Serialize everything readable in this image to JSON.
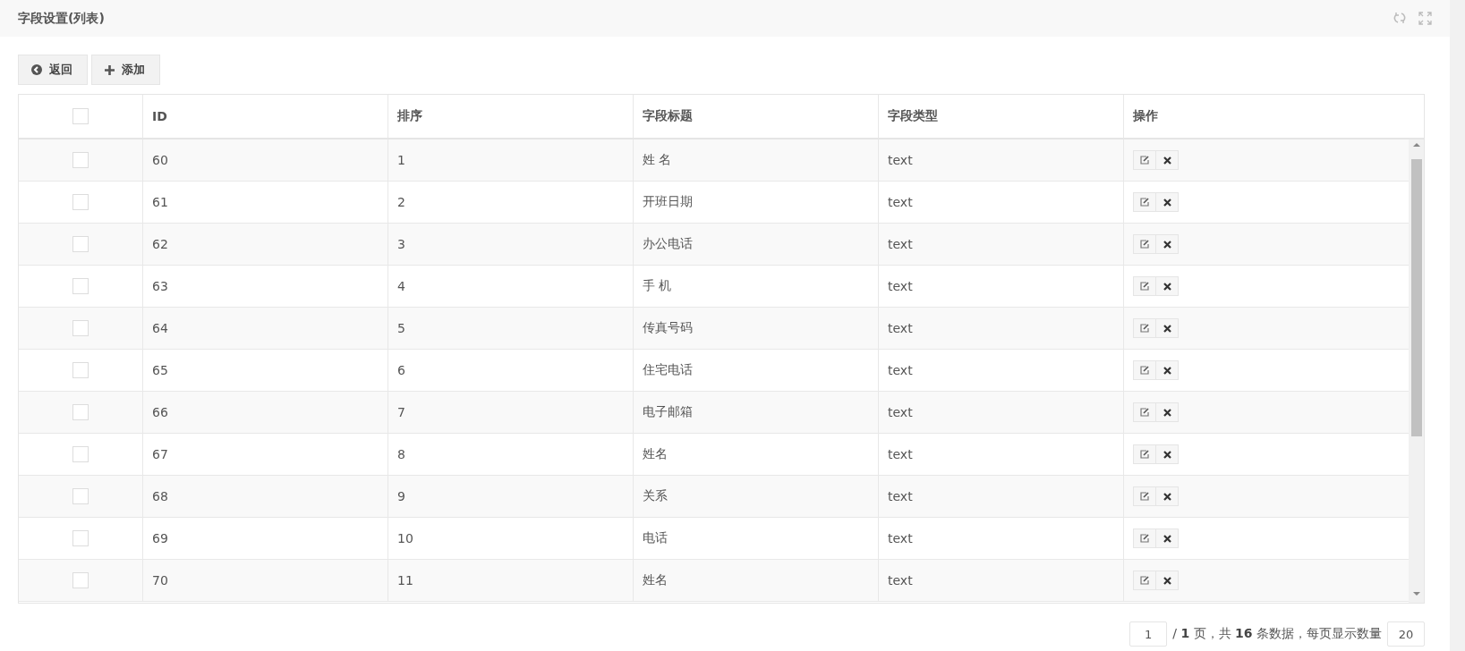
{
  "panel": {
    "title": "字段设置(列表)"
  },
  "toolbar": [
    {
      "kind": "back",
      "label": "返回"
    },
    {
      "kind": "add",
      "label": "添加"
    }
  ],
  "table": {
    "select_all_checked": false,
    "columns": [
      "ID",
      "排序",
      "字段标题",
      "字段类型",
      "操作"
    ],
    "rows": [
      {
        "checked": false,
        "id": "60",
        "order": "1",
        "title": "姓 名",
        "type": "text"
      },
      {
        "checked": false,
        "id": "61",
        "order": "2",
        "title": "开班日期",
        "type": "text"
      },
      {
        "checked": false,
        "id": "62",
        "order": "3",
        "title": "办公电话",
        "type": "text"
      },
      {
        "checked": false,
        "id": "63",
        "order": "4",
        "title": "手 机",
        "type": "text"
      },
      {
        "checked": false,
        "id": "64",
        "order": "5",
        "title": "传真号码",
        "type": "text"
      },
      {
        "checked": false,
        "id": "65",
        "order": "6",
        "title": "住宅电话",
        "type": "text"
      },
      {
        "checked": false,
        "id": "66",
        "order": "7",
        "title": "电子邮箱",
        "type": "text"
      },
      {
        "checked": false,
        "id": "67",
        "order": "8",
        "title": "姓名",
        "type": "text"
      },
      {
        "checked": false,
        "id": "68",
        "order": "9",
        "title": "关系",
        "type": "text"
      },
      {
        "checked": false,
        "id": "69",
        "order": "10",
        "title": "电话",
        "type": "text"
      },
      {
        "checked": false,
        "id": "70",
        "order": "11",
        "title": "姓名",
        "type": "text"
      }
    ]
  },
  "pagination": {
    "page": "1",
    "summary": "/ **1** 页，共 **16** 条数据，每页显示数量",
    "page_size": "20"
  }
}
